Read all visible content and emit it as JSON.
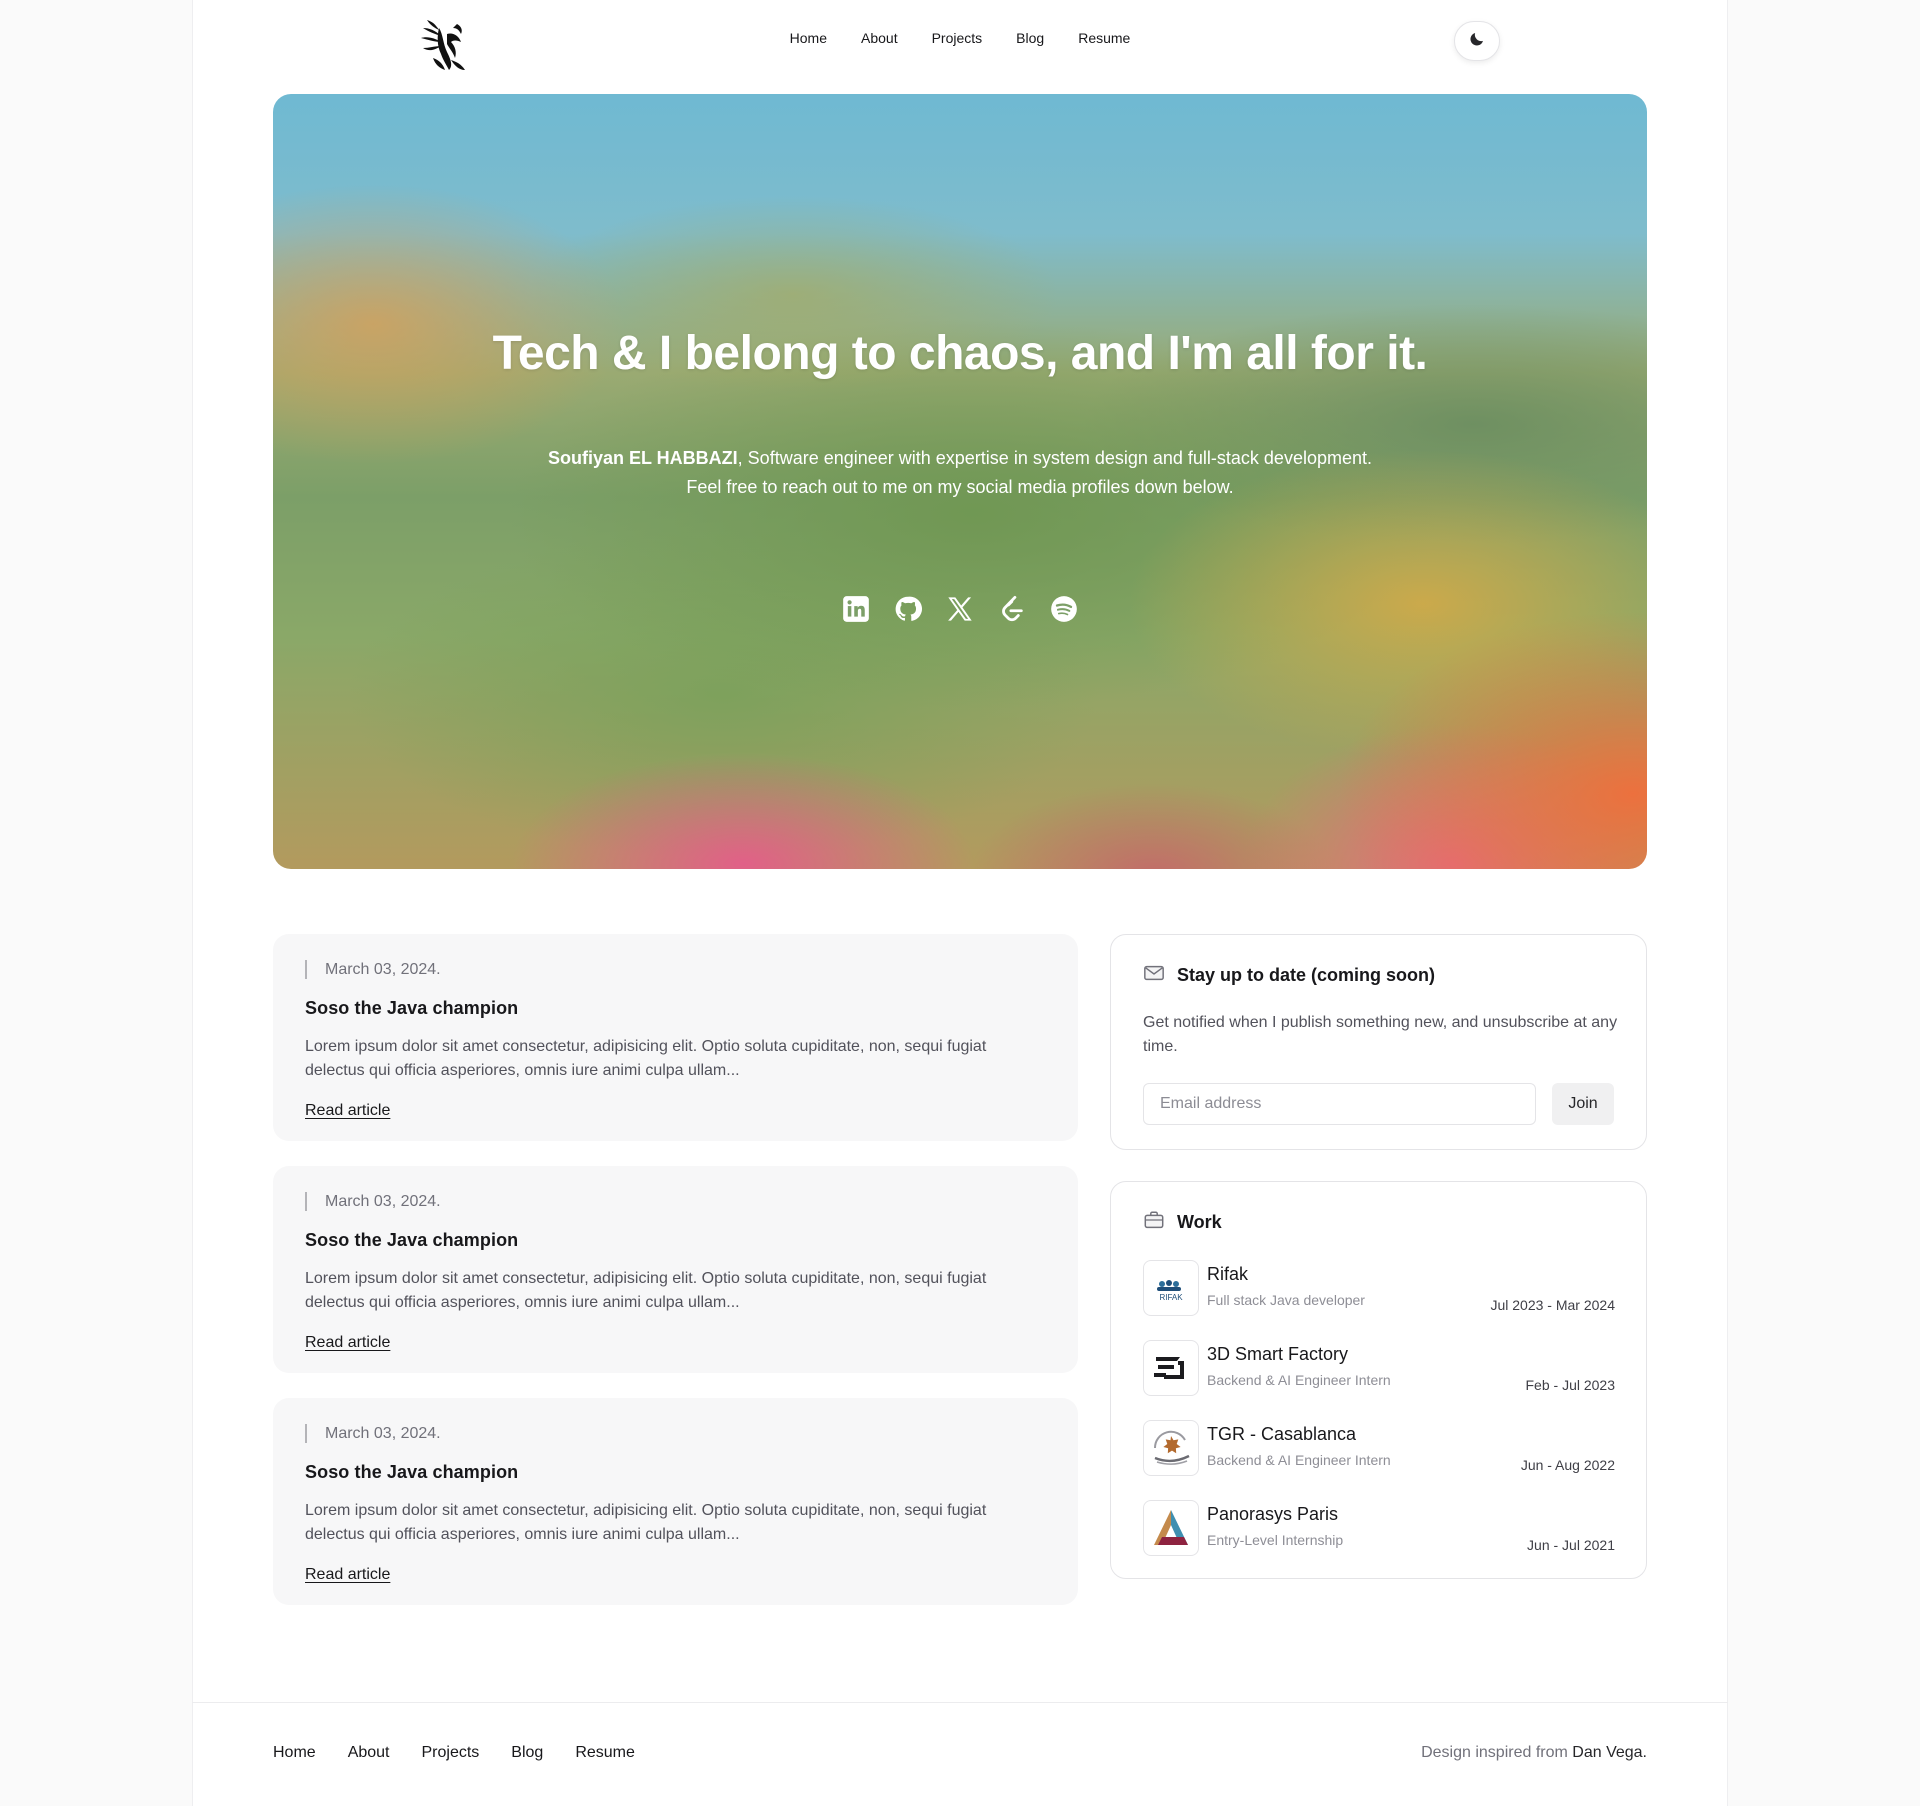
{
  "header": {
    "nav": [
      "Home",
      "About",
      "Projects",
      "Blog",
      "Resume"
    ]
  },
  "hero": {
    "title": "Tech & I belong to chaos, and I'm all for it.",
    "name": "Soufiyan EL HABBAZI",
    "line1_rest": ", Software engineer with expertise in system design and full-stack development.",
    "line2": "Feel free to reach out to me on my social media profiles down below.",
    "socials": [
      "linkedin-icon",
      "github-icon",
      "x-icon",
      "leetcode-icon",
      "spotify-icon"
    ]
  },
  "articles": [
    {
      "date": "March 03, 2024.",
      "title": "Soso the Java champion",
      "body": "Lorem ipsum dolor sit amet consectetur, adipisicing elit. Optio soluta cupiditate, non, sequi fugiat delectus qui officia asperiores, omnis iure animi culpa ullam...",
      "link": "Read article"
    },
    {
      "date": "March 03, 2024.",
      "title": "Soso the Java champion",
      "body": "Lorem ipsum dolor sit amet consectetur, adipisicing elit. Optio soluta cupiditate, non, sequi fugiat delectus qui officia asperiores, omnis iure animi culpa ullam...",
      "link": "Read article"
    },
    {
      "date": "March 03, 2024.",
      "title": "Soso the Java champion",
      "body": "Lorem ipsum dolor sit amet consectetur, adipisicing elit. Optio soluta cupiditate, non, sequi fugiat delectus qui officia asperiores, omnis iure animi culpa ullam...",
      "link": "Read article"
    }
  ],
  "newsletter": {
    "title": "Stay up to date (coming soon)",
    "text": "Get notified when I publish something new, and unsubscribe at any time.",
    "placeholder": "Email address",
    "button": "Join"
  },
  "work": {
    "title": "Work",
    "jobs": [
      {
        "company": "Rifak",
        "role": "Full stack Java developer",
        "dates": "Jul 2023 - Mar 2024",
        "logo_text": "RIFAK"
      },
      {
        "company": "3D Smart Factory",
        "role": "Backend & AI Engineer Intern",
        "dates": "Feb - Jul 2023"
      },
      {
        "company": "TGR - Casablanca",
        "role": "Backend & AI Engineer Intern",
        "dates": "Jun - Aug 2022"
      },
      {
        "company": "Panorasys Paris",
        "role": "Entry-Level Internship",
        "dates": "Jun - Jul 2021"
      }
    ]
  },
  "footer": {
    "nav": [
      "Home",
      "About",
      "Projects",
      "Blog",
      "Resume"
    ],
    "credit_prefix": "Design inspired from ",
    "credit_name": "Dan Vega."
  }
}
